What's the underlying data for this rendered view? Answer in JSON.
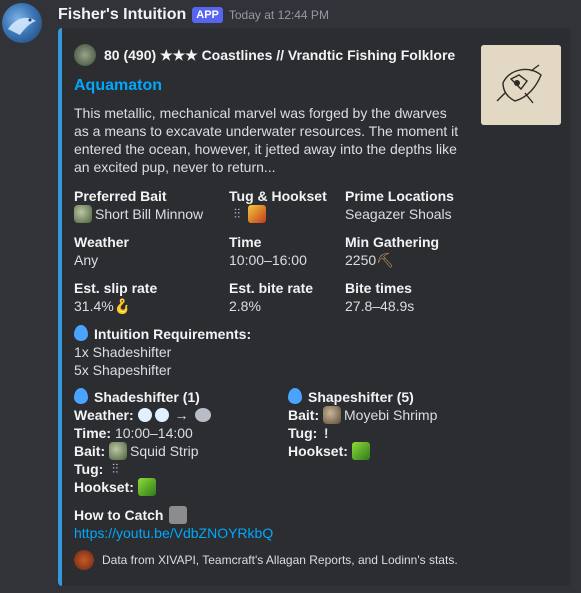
{
  "message": {
    "username": "Fisher's Intuition",
    "app_tag": "APP",
    "timestamp": "Today at 12:44 PM"
  },
  "embed": {
    "color": "#3498db",
    "author": "80 (490) ★★★ Coastlines // Vrandtic Fishing Folklore",
    "title": "Aquamaton",
    "description": "This metallic, mechanical marvel was forged by the dwarves as a means to excavate underwater resources. The moment it entered the ocean, however, it jetted away into the depths like an excited pup, never to return...",
    "fields": [
      {
        "name": "Preferred Bait",
        "value": "Short Bill Minnow",
        "icon": "minnow-icon"
      },
      {
        "name": "Tug & Hookset",
        "icons": [
          "tug-heavy-icon",
          "powerful-hookset-icon"
        ]
      },
      {
        "name": "Prime Locations",
        "value": "Seagazer Shoals"
      },
      {
        "name": "Weather",
        "value": "Any"
      },
      {
        "name": "Time",
        "value": "10:00–16:00"
      },
      {
        "name": "Min Gathering",
        "value": "2250",
        "icon": "pickaxe-icon"
      },
      {
        "name": "Est. slip rate",
        "value": "31.4%",
        "icon": "slip-icon"
      },
      {
        "name": "Est. bite rate",
        "value": "2.8%"
      },
      {
        "name": "Bite times",
        "value": "27.8–48.9s"
      }
    ],
    "intuition": {
      "title": "Intuition Requirements:",
      "lines": [
        "1x Shadeshifter",
        "5x Shapeshifter"
      ]
    },
    "shadeshifter": {
      "title": "Shadeshifter (1)",
      "weather_label": "Weather:",
      "time_label": "Time:",
      "time_value": "10:00–14:00",
      "bait_label": "Bait:",
      "bait_value": "Squid Strip",
      "tug_label": "Tug:",
      "hookset_label": "Hookset:"
    },
    "shapeshifter": {
      "title": "Shapeshifter (5)",
      "bait_label": "Bait:",
      "bait_value": "Moyebi Shrimp",
      "tug_label": "Tug:",
      "hookset_label": "Hookset:"
    },
    "how_to_catch": {
      "title": "How to Catch",
      "link": "https://youtu.be/VdbZNOYRkbQ"
    },
    "footer": "Data from XIVAPI, Teamcraft's Allagan Reports, and Lodinn's stats."
  }
}
